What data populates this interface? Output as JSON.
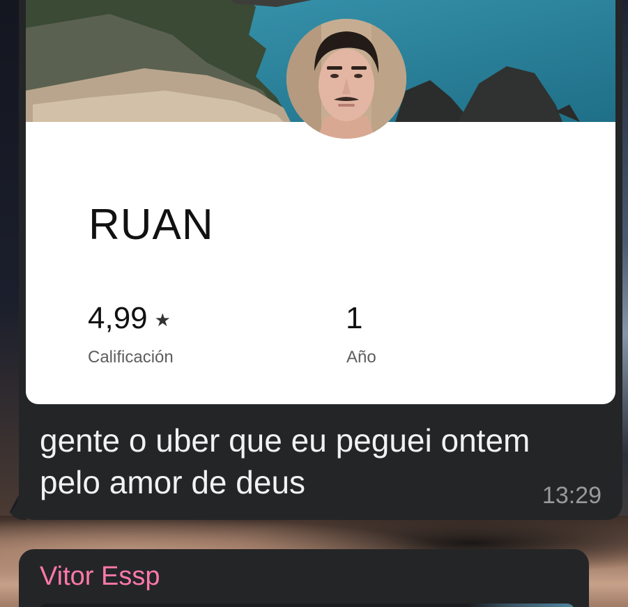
{
  "message": {
    "card": {
      "driver_name": "RUAN",
      "rating_value": "4,99",
      "rating_star": "★",
      "rating_label": "Calificación",
      "years_value": "1",
      "years_label": "Año"
    },
    "text": "gente o uber que eu peguei ontem pelo amor de deus",
    "time": "13:29"
  },
  "next_message": {
    "sender": "Vitor Essp"
  },
  "colors": {
    "bubble": "#242527",
    "sender_name": "#ff79a8",
    "timestamp": "#9a9a9a",
    "message_text": "#f2f2f2"
  }
}
